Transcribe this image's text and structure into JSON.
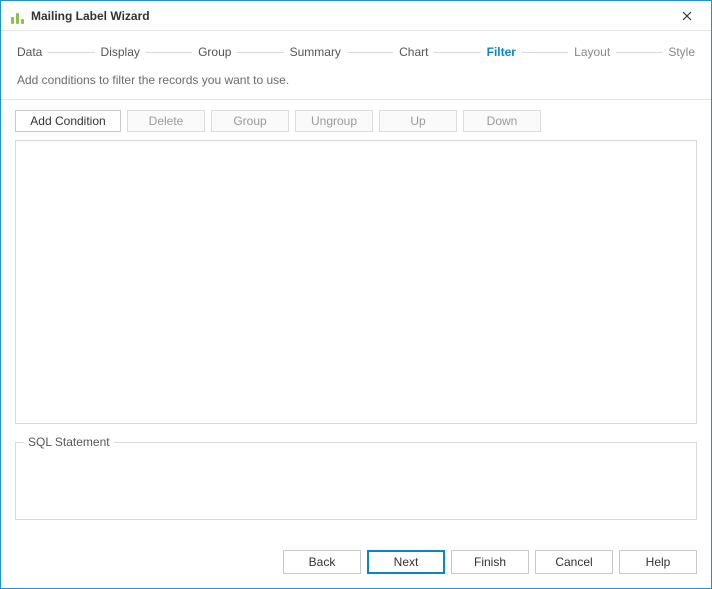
{
  "window": {
    "title": "Mailing Label Wizard"
  },
  "steps": [
    {
      "label": "Data",
      "state": "enabled"
    },
    {
      "label": "Display",
      "state": "enabled"
    },
    {
      "label": "Group",
      "state": "enabled"
    },
    {
      "label": "Summary",
      "state": "enabled"
    },
    {
      "label": "Chart",
      "state": "enabled"
    },
    {
      "label": "Filter",
      "state": "active"
    },
    {
      "label": "Layout",
      "state": "disabled"
    },
    {
      "label": "Style",
      "state": "disabled"
    }
  ],
  "description": "Add conditions to filter the records you want to use.",
  "toolbar": {
    "add": "Add Condition",
    "delete": "Delete",
    "group": "Group",
    "ungroup": "Ungroup",
    "up": "Up",
    "down": "Down"
  },
  "sql_group": {
    "label": "SQL Statement",
    "text": ""
  },
  "footer": {
    "back": "Back",
    "next": "Next",
    "finish": "Finish",
    "cancel": "Cancel",
    "help": "Help"
  }
}
